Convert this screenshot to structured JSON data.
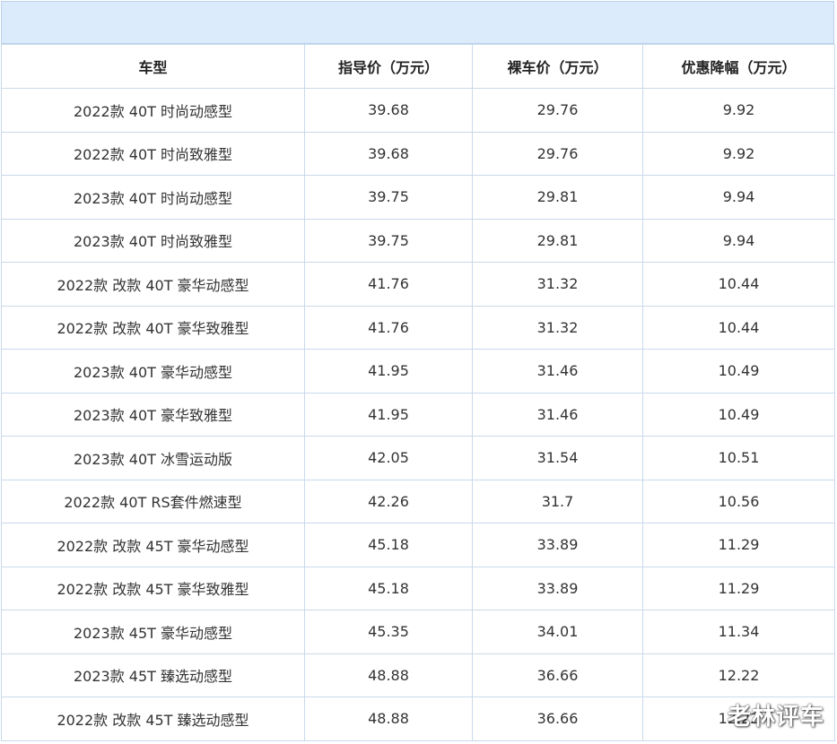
{
  "table": {
    "headers": [
      "车型",
      "指导价（万元）",
      "裸车价（万元）",
      "优惠降幅（万元）"
    ],
    "rows": [
      [
        "2022款 40T 时尚动感型",
        "39.68",
        "29.76",
        "9.92"
      ],
      [
        "2022款 40T 时尚致雅型",
        "39.68",
        "29.76",
        "9.92"
      ],
      [
        "2023款 40T 时尚动感型",
        "39.75",
        "29.81",
        "9.94"
      ],
      [
        "2023款 40T 时尚致雅型",
        "39.75",
        "29.81",
        "9.94"
      ],
      [
        "2022款 改款 40T 豪华动感型",
        "41.76",
        "31.32",
        "10.44"
      ],
      [
        "2022款 改款 40T 豪华致雅型",
        "41.76",
        "31.32",
        "10.44"
      ],
      [
        "2023款 40T 豪华动感型",
        "41.95",
        "31.46",
        "10.49"
      ],
      [
        "2023款 40T 豪华致雅型",
        "41.95",
        "31.46",
        "10.49"
      ],
      [
        "2023款 40T 冰雪运动版",
        "42.05",
        "31.54",
        "10.51"
      ],
      [
        "2022款 40T RS套件燃速型",
        "42.26",
        "31.7",
        "10.56"
      ],
      [
        "2022款 改款 45T 豪华动感型",
        "45.18",
        "33.89",
        "11.29"
      ],
      [
        "2022款 改款 45T 豪华致雅型",
        "45.18",
        "33.89",
        "11.29"
      ],
      [
        "2023款 45T 豪华动感型",
        "45.35",
        "34.01",
        "11.34"
      ],
      [
        "2023款 45T 臻选动感型",
        "48.88",
        "36.66",
        "12.22"
      ],
      [
        "2022款 改款 45T 臻选动感型",
        "48.88",
        "36.66",
        "12.22"
      ]
    ]
  },
  "watermark": "老林评车",
  "colors": {
    "header_band": "#dcebfb",
    "border": "#c9d9ea",
    "text": "#333333"
  }
}
